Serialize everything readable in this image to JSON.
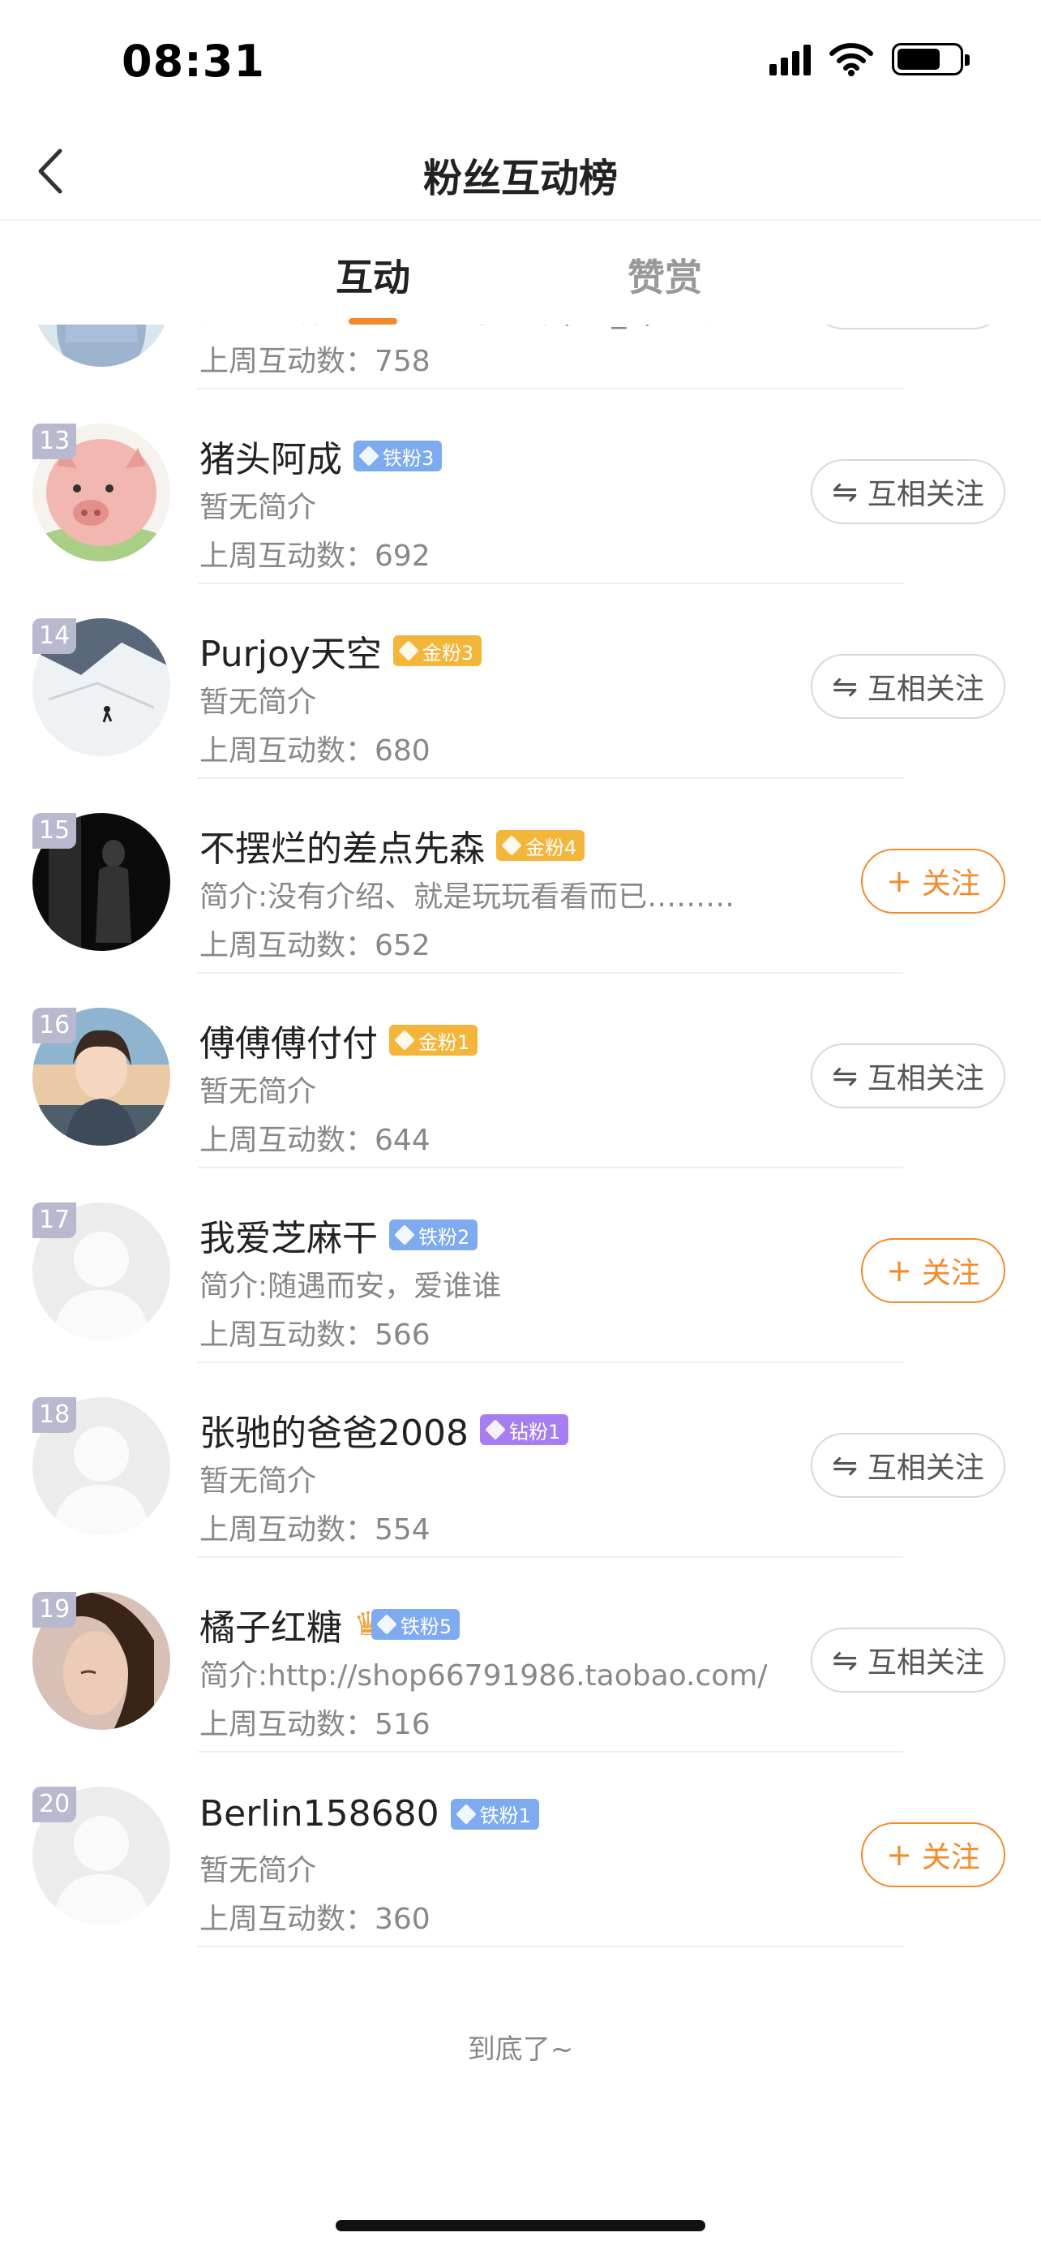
{
  "status_bar": {
    "time": "08:31"
  },
  "header": {
    "title": "粉丝互动榜"
  },
  "tabs": [
    {
      "label": "互动",
      "active": true
    },
    {
      "label": "赞赏",
      "active": false
    }
  ],
  "buttons": {
    "mutual_label": "互相关注",
    "follow_label": "关注",
    "mutual_symbol": "⇋",
    "follow_symbol": "+"
  },
  "rows": [
    {
      "rank": "",
      "name": "",
      "badge": "",
      "badge_type": "",
      "intro": "简介:一棵无人知道的小韭菜(ง •̀_•́)ง加油",
      "count": "上周互动数：758",
      "action": "mutual",
      "avatar": "avatar-girl"
    },
    {
      "rank": "13",
      "name": "猪头阿成",
      "badge": "铁粉3",
      "badge_type": "iron",
      "intro": "暂无简介",
      "count": "上周互动数：692",
      "action": "mutual",
      "avatar": "avatar-pig"
    },
    {
      "rank": "14",
      "name": "Purjoy天空",
      "badge": "金粉3",
      "badge_type": "gold",
      "intro": "暂无简介",
      "count": "上周互动数：680",
      "action": "mutual",
      "avatar": "avatar-ski"
    },
    {
      "rank": "15",
      "name": "不摆烂的差点先森",
      "badge": "金粉4",
      "badge_type": "gold",
      "intro": "简介:没有介绍、就是玩玩看看而已………",
      "count": "上周互动数：652",
      "action": "follow",
      "avatar": "avatar-dark"
    },
    {
      "rank": "16",
      "name": "傅傅傅付付",
      "badge": "金粉1",
      "badge_type": "gold",
      "intro": "暂无简介",
      "count": "上周互动数：644",
      "action": "mutual",
      "avatar": "avatar-anime"
    },
    {
      "rank": "17",
      "name": "我爱芝麻干",
      "badge": "铁粉2",
      "badge_type": "iron",
      "intro": "简介:随遇而安，爱谁谁",
      "count": "上周互动数：566",
      "action": "follow",
      "avatar": "avatar-default"
    },
    {
      "rank": "18",
      "name": "张驰的爸爸2008",
      "badge": "钻粉1",
      "badge_type": "diamond",
      "intro": "暂无简介",
      "count": "上周互动数：554",
      "action": "mutual",
      "avatar": "avatar-default"
    },
    {
      "rank": "19",
      "name": "橘子红糖",
      "badge": "铁粉5",
      "badge_type": "iron-crown",
      "intro": "简介:http://shop66791986.taobao.com/",
      "count": "上周互动数：516",
      "action": "mutual",
      "avatar": "avatar-woman"
    },
    {
      "rank": "20",
      "name": "Berlin158680",
      "badge": "铁粉1",
      "badge_type": "iron",
      "intro": "暂无简介",
      "count": "上周互动数：360",
      "action": "follow",
      "avatar": "avatar-default"
    }
  ],
  "footer": {
    "end_text": "到底了~"
  },
  "colors": {
    "accent": "#f28a2a",
    "iron": "#7eaaf0",
    "gold": "#f3b53a",
    "diamond": "#a77ef2",
    "rank_bg": "#b8b9cf"
  }
}
